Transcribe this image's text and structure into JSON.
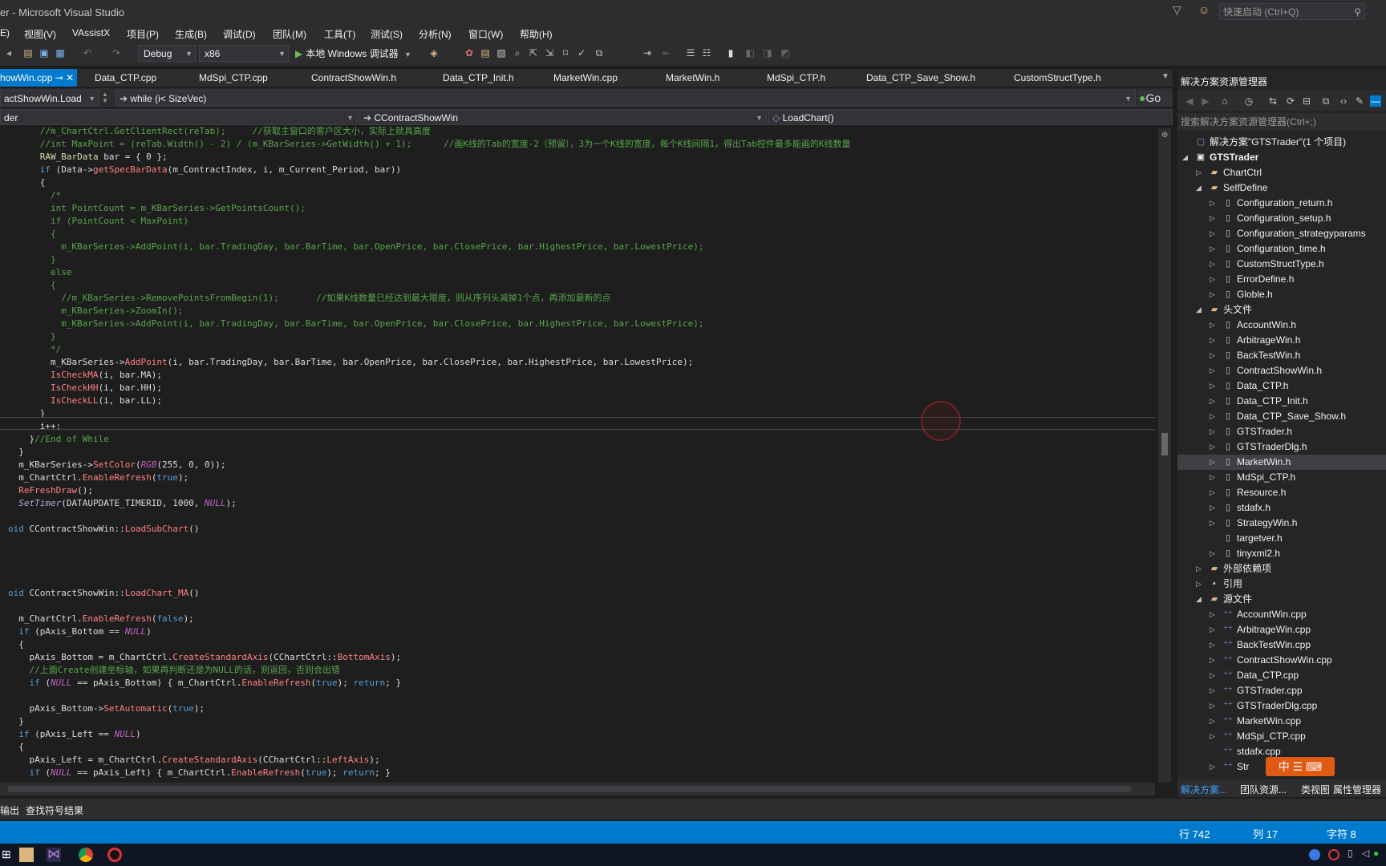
{
  "window": {
    "title": "er - Microsoft Visual Studio",
    "quick_launch": "快速启动 (Ctrl+Q)"
  },
  "menu": [
    "E)",
    "视图(V)",
    "VAssistX",
    "项目(P)",
    "生成(B)",
    "调试(D)",
    "团队(M)",
    "工具(T)",
    "测试(S)",
    "分析(N)",
    "窗口(W)",
    "帮助(H)"
  ],
  "toolbar": {
    "config": "Debug",
    "platform": "x86",
    "run_label": "本地 Windows 调试器"
  },
  "tabs": [
    {
      "label": "howWin.cpp",
      "active": true
    },
    {
      "label": "Data_CTP.cpp"
    },
    {
      "label": "MdSpi_CTP.cpp"
    },
    {
      "label": "ContractShowWin.h"
    },
    {
      "label": "Data_CTP_Init.h"
    },
    {
      "label": "MarketWin.cpp"
    },
    {
      "label": "MarketWin.h"
    },
    {
      "label": "MdSpi_CTP.h"
    },
    {
      "label": "Data_CTP_Save_Show.h"
    },
    {
      "label": "CustomStructType.h"
    }
  ],
  "nav": {
    "method": "actShowWin.Load",
    "scope": "while (i< SizeVec)",
    "go": "Go",
    "project": "der",
    "class": "CContractShowWin",
    "member": "LoadChart()"
  },
  "code_lines": [
    {
      "indent": 6,
      "parts": [
        [
          "cm",
          "//m_ChartCtrl.GetClientRect(reTab);     //获取主窗口的客户区大小，实际上就具高度"
        ]
      ]
    },
    {
      "indent": 6,
      "parts": [
        [
          "cm",
          "//int MaxPoint = (reTab.Width() - 2) / (m_KBarSeries->GetWidth() + 1);      //画K线的Tab的宽度-2（预留），3为一个K线的宽度，每个K线间隔1，得出Tab控件最多能画的K线数量"
        ]
      ]
    },
    {
      "indent": 6,
      "parts": [
        [
          "ty",
          "RAW_BarData"
        ],
        [
          "",
          " bar = { 0 };"
        ]
      ]
    },
    {
      "indent": 6,
      "parts": [
        [
          "kw",
          "if"
        ],
        [
          "",
          " (Data->"
        ],
        [
          "fn",
          "getSpecBarData"
        ],
        [
          "",
          "(m_ContractIndex, i, m_Current_Period, bar))"
        ]
      ]
    },
    {
      "indent": 6,
      "parts": [
        [
          "",
          "{"
        ]
      ]
    },
    {
      "indent": 8,
      "parts": [
        [
          "cm",
          "/*"
        ]
      ]
    },
    {
      "indent": 8,
      "parts": [
        [
          "cm",
          "int PointCount = m_KBarSeries->GetPointsCount();"
        ]
      ]
    },
    {
      "indent": 8,
      "parts": [
        [
          "cm",
          "if (PointCount < MaxPoint)"
        ]
      ]
    },
    {
      "indent": 8,
      "parts": [
        [
          "cm",
          "{"
        ]
      ]
    },
    {
      "indent": 10,
      "parts": [
        [
          "cm",
          "m_KBarSeries->AddPoint(i, bar.TradingDay, bar.BarTime, bar.OpenPrice, bar.ClosePrice, bar.HighestPrice, bar.LowestPrice);"
        ]
      ]
    },
    {
      "indent": 8,
      "parts": [
        [
          "cm",
          "}"
        ]
      ]
    },
    {
      "indent": 8,
      "parts": [
        [
          "cm",
          "else"
        ]
      ]
    },
    {
      "indent": 8,
      "parts": [
        [
          "cm",
          "{"
        ]
      ]
    },
    {
      "indent": 10,
      "parts": [
        [
          "cm",
          "//m_KBarSeries->RemovePointsFromBegin(1);       //如果K线数量已经达到最大限度，则从序列头减掉1个点，再添加最新的点"
        ]
      ]
    },
    {
      "indent": 10,
      "parts": [
        [
          "cm",
          "m_KBarSeries->ZoomIn();"
        ]
      ]
    },
    {
      "indent": 10,
      "parts": [
        [
          "cm",
          "m_KBarSeries->AddPoint(i, bar.TradingDay, bar.BarTime, bar.OpenPrice, bar.ClosePrice, bar.HighestPrice, bar.LowestPrice);"
        ]
      ]
    },
    {
      "indent": 8,
      "parts": [
        [
          "cm",
          "}"
        ]
      ]
    },
    {
      "indent": 8,
      "parts": [
        [
          "cm",
          "*/"
        ]
      ]
    },
    {
      "indent": 8,
      "parts": [
        [
          "",
          "m_KBarSeries->"
        ],
        [
          "fn",
          "AddPoint"
        ],
        [
          "",
          "(i, bar.TradingDay, bar.BarTime, bar.OpenPrice, bar.ClosePrice, bar.HighestPrice, bar.LowestPrice);"
        ]
      ]
    },
    {
      "indent": 8,
      "parts": [
        [
          "fn",
          "IsCheckMA"
        ],
        [
          "",
          "(i, bar.MA);"
        ]
      ]
    },
    {
      "indent": 8,
      "parts": [
        [
          "fn",
          "IsCheckHH"
        ],
        [
          "",
          "(i, bar.HH);"
        ]
      ]
    },
    {
      "indent": 8,
      "parts": [
        [
          "fn",
          "IsCheckLL"
        ],
        [
          "",
          "(i, bar.LL);"
        ]
      ]
    },
    {
      "indent": 6,
      "parts": [
        [
          "",
          "}"
        ]
      ]
    },
    {
      "indent": 6,
      "parts": [
        [
          "",
          "i++;"
        ]
      ]
    },
    {
      "indent": 4,
      "parts": [
        [
          "",
          "}"
        ],
        [
          "cm",
          "//End of While"
        ]
      ]
    },
    {
      "indent": 2,
      "parts": [
        [
          "",
          "}"
        ]
      ]
    },
    {
      "indent": 2,
      "parts": [
        [
          "",
          "m_KBarSeries->"
        ],
        [
          "fn",
          "SetColor"
        ],
        [
          "",
          "("
        ],
        [
          "mac",
          "RGB"
        ],
        [
          "",
          "(255, 0, 0));"
        ]
      ]
    },
    {
      "indent": 2,
      "parts": [
        [
          "",
          "m_ChartCtrl."
        ],
        [
          "fn",
          "EnableRefresh"
        ],
        [
          "",
          "("
        ],
        [
          "kw",
          "true"
        ],
        [
          "",
          ");"
        ]
      ]
    },
    {
      "indent": 2,
      "parts": [
        [
          "fn",
          "ReFreshDraw"
        ],
        [
          "",
          "();"
        ]
      ]
    },
    {
      "indent": 2,
      "parts": [
        [
          "it",
          "SetTimer"
        ],
        [
          "",
          "(DATAUPDATE_TIMERID, 1000, "
        ],
        [
          "mac",
          "NULL"
        ],
        [
          "",
          ");"
        ]
      ]
    },
    {
      "indent": 0,
      "parts": [
        [
          "",
          ""
        ]
      ]
    },
    {
      "indent": 0,
      "parts": [
        [
          "kw",
          "oid"
        ],
        [
          "",
          " CContractShowWin::"
        ],
        [
          "fn",
          "LoadSubChart"
        ],
        [
          "",
          "()"
        ]
      ]
    },
    {
      "indent": 0,
      "parts": [
        [
          "",
          ""
        ]
      ]
    },
    {
      "indent": 0,
      "parts": [
        [
          "",
          ""
        ]
      ]
    },
    {
      "indent": 0,
      "parts": [
        [
          "",
          ""
        ]
      ]
    },
    {
      "indent": 0,
      "parts": [
        [
          "",
          ""
        ]
      ]
    },
    {
      "indent": 0,
      "parts": [
        [
          "kw",
          "oid"
        ],
        [
          "",
          " CContractShowWin::"
        ],
        [
          "fn",
          "LoadChart_MA"
        ],
        [
          "",
          "()"
        ]
      ]
    },
    {
      "indent": 0,
      "parts": [
        [
          "",
          ""
        ]
      ]
    },
    {
      "indent": 2,
      "parts": [
        [
          "",
          "m_ChartCtrl."
        ],
        [
          "fn",
          "EnableRefresh"
        ],
        [
          "",
          "("
        ],
        [
          "kw",
          "false"
        ],
        [
          "",
          ");"
        ]
      ]
    },
    {
      "indent": 2,
      "parts": [
        [
          "kw",
          "if"
        ],
        [
          "",
          " (pAxis_Bottom == "
        ],
        [
          "mac",
          "NULL"
        ],
        [
          "",
          ")"
        ]
      ]
    },
    {
      "indent": 2,
      "parts": [
        [
          "",
          "{"
        ]
      ]
    },
    {
      "indent": 4,
      "parts": [
        [
          "",
          "pAxis_Bottom = m_ChartCtrl."
        ],
        [
          "fn",
          "CreateStandardAxis"
        ],
        [
          "",
          "(CChartCtrl::"
        ],
        [
          "fn",
          "BottomAxis"
        ],
        [
          "",
          ");"
        ]
      ]
    },
    {
      "indent": 4,
      "parts": [
        [
          "cm",
          "//上面Create创建坐标轴，如果再判断还是为NULL的话，则返回，否则会出错"
        ]
      ]
    },
    {
      "indent": 4,
      "parts": [
        [
          "kw",
          "if"
        ],
        [
          "",
          " ("
        ],
        [
          "mac",
          "NULL"
        ],
        [
          "",
          " == pAxis_Bottom) { m_ChartCtrl."
        ],
        [
          "fn",
          "EnableRefresh"
        ],
        [
          "",
          "("
        ],
        [
          "kw",
          "true"
        ],
        [
          "",
          "); "
        ],
        [
          "kw",
          "return"
        ],
        [
          "",
          "; }"
        ]
      ]
    },
    {
      "indent": 0,
      "parts": [
        [
          "",
          ""
        ]
      ]
    },
    {
      "indent": 4,
      "parts": [
        [
          "",
          "pAxis_Bottom->"
        ],
        [
          "fn",
          "SetAutomatic"
        ],
        [
          "",
          "("
        ],
        [
          "kw",
          "true"
        ],
        [
          "",
          ");"
        ]
      ]
    },
    {
      "indent": 2,
      "parts": [
        [
          "",
          "}"
        ]
      ]
    },
    {
      "indent": 2,
      "parts": [
        [
          "kw",
          "if"
        ],
        [
          "",
          " (pAxis_Left == "
        ],
        [
          "mac",
          "NULL"
        ],
        [
          "",
          ")"
        ]
      ]
    },
    {
      "indent": 2,
      "parts": [
        [
          "",
          "{"
        ]
      ]
    },
    {
      "indent": 4,
      "parts": [
        [
          "",
          "pAxis_Left = m_ChartCtrl."
        ],
        [
          "fn",
          "CreateStandardAxis"
        ],
        [
          "",
          "(CChartCtrl::"
        ],
        [
          "fn",
          "LeftAxis"
        ],
        [
          "",
          ");"
        ]
      ]
    },
    {
      "indent": 4,
      "parts": [
        [
          "kw",
          "if"
        ],
        [
          "",
          " ("
        ],
        [
          "mac",
          "NULL"
        ],
        [
          "",
          " == pAxis_Left) { m_ChartCtrl."
        ],
        [
          "fn",
          "EnableRefresh"
        ],
        [
          "",
          "("
        ],
        [
          "kw",
          "true"
        ],
        [
          "",
          "); "
        ],
        [
          "kw",
          "return"
        ],
        [
          "",
          "; }"
        ]
      ]
    }
  ],
  "solution_explorer": {
    "header": "解决方案资源管理器",
    "search_placeholder": "搜索解决方案资源管理器(Ctrl+;)",
    "tree": [
      {
        "level": 0,
        "label": "解决方案\"GTSTrader\"(1 个项目)",
        "icon": "solution-icon",
        "exp": ""
      },
      {
        "level": 0,
        "label": "GTSTrader",
        "icon": "project-icon",
        "exp": "open",
        "bold": true
      },
      {
        "level": 1,
        "label": "ChartCtrl",
        "icon": "folder-icon",
        "exp": "closed"
      },
      {
        "level": 1,
        "label": "SelfDefine",
        "icon": "folder-icon",
        "exp": "open"
      },
      {
        "level": 2,
        "label": "Configuration_return.h",
        "icon": "header-icon",
        "exp": "closed"
      },
      {
        "level": 2,
        "label": "Configuration_setup.h",
        "icon": "header-icon",
        "exp": "closed"
      },
      {
        "level": 2,
        "label": "Configuration_strategyparams",
        "icon": "header-icon",
        "exp": "closed"
      },
      {
        "level": 2,
        "label": "Configuration_time.h",
        "icon": "header-icon",
        "exp": "closed"
      },
      {
        "level": 2,
        "label": "CustomStructType.h",
        "icon": "header-icon",
        "exp": "closed"
      },
      {
        "level": 2,
        "label": "ErrorDefine.h",
        "icon": "header-icon",
        "exp": "closed"
      },
      {
        "level": 2,
        "label": "Globle.h",
        "icon": "header-icon",
        "exp": "closed"
      },
      {
        "level": 1,
        "label": "头文件",
        "icon": "folder-icon",
        "exp": "open"
      },
      {
        "level": 2,
        "label": "AccountWin.h",
        "icon": "header-icon",
        "exp": "closed"
      },
      {
        "level": 2,
        "label": "ArbitrageWin.h",
        "icon": "header-icon",
        "exp": "closed"
      },
      {
        "level": 2,
        "label": "BackTestWin.h",
        "icon": "header-icon",
        "exp": "closed"
      },
      {
        "level": 2,
        "label": "ContractShowWin.h",
        "icon": "header-icon",
        "exp": "closed"
      },
      {
        "level": 2,
        "label": "Data_CTP.h",
        "icon": "header-icon",
        "exp": "closed"
      },
      {
        "level": 2,
        "label": "Data_CTP_Init.h",
        "icon": "header-icon",
        "exp": "closed"
      },
      {
        "level": 2,
        "label": "Data_CTP_Save_Show.h",
        "icon": "header-icon",
        "exp": "closed"
      },
      {
        "level": 2,
        "label": "GTSTrader.h",
        "icon": "header-icon",
        "exp": "closed"
      },
      {
        "level": 2,
        "label": "GTSTraderDlg.h",
        "icon": "header-icon",
        "exp": "closed"
      },
      {
        "level": 2,
        "label": "MarketWin.h",
        "icon": "header-icon",
        "exp": "closed",
        "selected": true
      },
      {
        "level": 2,
        "label": "MdSpi_CTP.h",
        "icon": "header-icon",
        "exp": "closed"
      },
      {
        "level": 2,
        "label": "Resource.h",
        "icon": "header-icon",
        "exp": "closed"
      },
      {
        "level": 2,
        "label": "stdafx.h",
        "icon": "header-icon",
        "exp": "closed"
      },
      {
        "level": 2,
        "label": "StrategyWin.h",
        "icon": "header-icon",
        "exp": "closed"
      },
      {
        "level": 2,
        "label": "targetver.h",
        "icon": "header-icon",
        "exp": ""
      },
      {
        "level": 2,
        "label": "tinyxml2.h",
        "icon": "header-icon",
        "exp": "closed"
      },
      {
        "level": 1,
        "label": "外部依赖项",
        "icon": "folder-icon",
        "exp": "closed"
      },
      {
        "level": 1,
        "label": "引用",
        "icon": "reference-icon",
        "exp": "closed"
      },
      {
        "level": 1,
        "label": "源文件",
        "icon": "folder-icon",
        "exp": "open"
      },
      {
        "level": 2,
        "label": "AccountWin.cpp",
        "icon": "cpp-icon",
        "exp": "closed"
      },
      {
        "level": 2,
        "label": "ArbitrageWin.cpp",
        "icon": "cpp-icon",
        "exp": "closed"
      },
      {
        "level": 2,
        "label": "BackTestWin.cpp",
        "icon": "cpp-icon",
        "exp": "closed"
      },
      {
        "level": 2,
        "label": "ContractShowWin.cpp",
        "icon": "cpp-icon",
        "exp": "closed"
      },
      {
        "level": 2,
        "label": "Data_CTP.cpp",
        "icon": "cpp-icon",
        "exp": "closed"
      },
      {
        "level": 2,
        "label": "GTSTrader.cpp",
        "icon": "cpp-icon",
        "exp": "closed"
      },
      {
        "level": 2,
        "label": "GTSTraderDlg.cpp",
        "icon": "cpp-icon",
        "exp": "closed"
      },
      {
        "level": 2,
        "label": "MarketWin.cpp",
        "icon": "cpp-icon",
        "exp": "closed"
      },
      {
        "level": 2,
        "label": "MdSpi_CTP.cpp",
        "icon": "cpp-icon",
        "exp": "closed"
      },
      {
        "level": 2,
        "label": "stdafx.cpp",
        "icon": "cpp-icon",
        "exp": ""
      },
      {
        "level": 2,
        "label": "Str",
        "icon": "cpp-icon",
        "exp": "closed"
      }
    ],
    "bottom_tabs": [
      "解决方案...",
      "团队资源...",
      "类视图",
      "属性管理器"
    ]
  },
  "ime_badge": "中",
  "output_tabs": [
    "输出",
    "查找符号结果"
  ],
  "status": {
    "line": "行 742",
    "col": "列 17",
    "ch": "字符 8"
  },
  "colors": {
    "accent": "#007acc",
    "keyword": "#569cd6",
    "comment": "#57a64a",
    "function": "#ff8080",
    "macro": "#bd63c5"
  }
}
